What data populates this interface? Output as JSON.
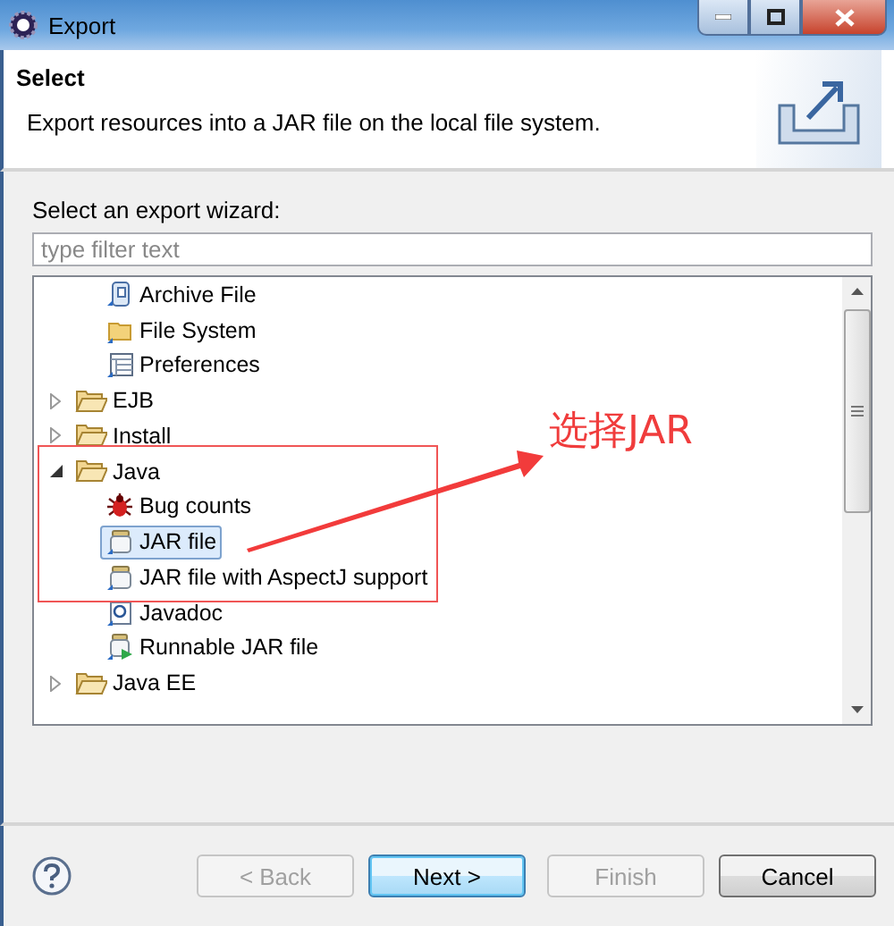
{
  "window": {
    "title": "Export"
  },
  "header": {
    "title": "Select",
    "description": "Export resources into a JAR file on the local file system."
  },
  "wizard_label": "Select an export wizard:",
  "filter": {
    "placeholder": "type filter text"
  },
  "tree": {
    "continued_children": [
      {
        "label": "Archive File",
        "kind": "archive",
        "selected": false
      },
      {
        "label": "File System",
        "kind": "folder-file",
        "selected": false
      },
      {
        "label": "Preferences",
        "kind": "preferences",
        "selected": false
      }
    ],
    "items": [
      {
        "label": "EJB",
        "expanded": false
      },
      {
        "label": "Install",
        "expanded": false
      },
      {
        "label": "Java",
        "expanded": true,
        "children": [
          {
            "label": "Bug counts",
            "kind": "bug",
            "selected": false
          },
          {
            "label": "JAR file",
            "kind": "jar",
            "selected": true
          },
          {
            "label": "JAR file with AspectJ support",
            "kind": "jar",
            "selected": false
          },
          {
            "label": "Javadoc",
            "kind": "javadoc",
            "selected": false
          },
          {
            "label": "Runnable JAR file",
            "kind": "runnable-jar",
            "selected": false
          }
        ]
      },
      {
        "label": "Java EE",
        "expanded": false
      }
    ]
  },
  "annotation": {
    "label": "选择JAR"
  },
  "buttons": [
    {
      "label": "< Back",
      "disabled": true,
      "default": false
    },
    {
      "label": "Next >",
      "disabled": false,
      "default": true
    },
    {
      "label": "Finish",
      "disabled": true,
      "default": false
    },
    {
      "label": "Cancel",
      "disabled": false,
      "default": false
    }
  ]
}
